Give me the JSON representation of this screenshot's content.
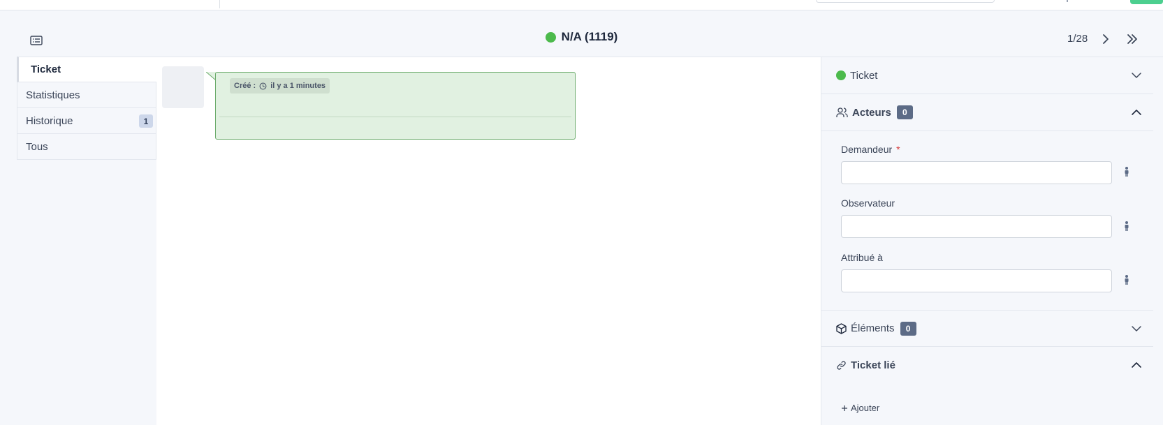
{
  "header": {
    "title": "N/A (1119)",
    "status_color": "#4cba4c",
    "pager": "1/28",
    "icons": {
      "list_toggle": "list-icon",
      "next": "chevron-right-icon",
      "last": "chevrons-right-icon"
    }
  },
  "tabs": [
    {
      "label": "Ticket",
      "active": true
    },
    {
      "label": "Statistiques"
    },
    {
      "label": "Historique",
      "badge": "1"
    },
    {
      "label": "Tous"
    }
  ],
  "timeline": {
    "item": {
      "created_label": "Créé :",
      "created_icon": "clock-icon",
      "created_value": "il y a 1 minutes",
      "bubble_color": "#e1f1e1"
    }
  },
  "panel": {
    "ticket": {
      "label": "Ticket",
      "status_color": "#4cba4c"
    },
    "actors": {
      "label": "Acteurs",
      "count": "0",
      "icon": "users-icon",
      "fields": [
        {
          "label": "Demandeur",
          "required": "*",
          "value": ""
        },
        {
          "label": "Observateur",
          "value": ""
        },
        {
          "label": "Attribué à",
          "value": ""
        }
      ]
    },
    "items": {
      "label": "Éléments",
      "count": "0",
      "icon": "box-icon"
    },
    "linked": {
      "label": "Ticket lié",
      "icon": "link-icon",
      "add_label": "Ajouter"
    }
  }
}
